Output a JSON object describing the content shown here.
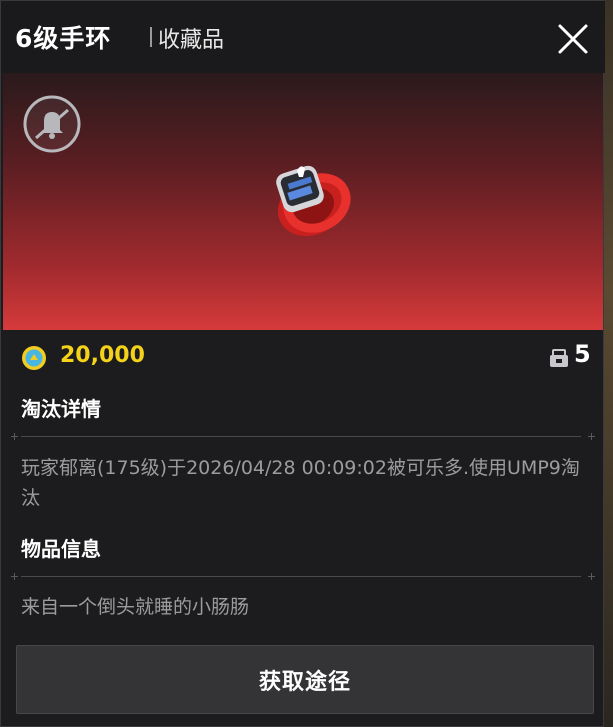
{
  "header": {
    "title": "6级手环",
    "category": "收藏品"
  },
  "item": {
    "price": "20,000",
    "stack_count": "5",
    "colors": {
      "price": "#f4d21a",
      "hero_top": "#2a1a1c",
      "hero_bottom": "#d63a3a",
      "panel": "#1c1c1e"
    }
  },
  "sections": {
    "elimination": {
      "title": "淘汰详情",
      "text": "玩家郁离(175级)于2026/04/28 00:09:02被可乐多.使用UMP9淘汰"
    },
    "info": {
      "title": "物品信息",
      "text": "来自一个倒头就睡的小肠肠"
    }
  },
  "actions": {
    "obtain_label": "获取途径"
  },
  "icons": {
    "close": "close-icon",
    "badge": "bell-badge-icon",
    "coin": "coin-icon",
    "stack": "stack-icon",
    "item": "wristband-icon"
  }
}
